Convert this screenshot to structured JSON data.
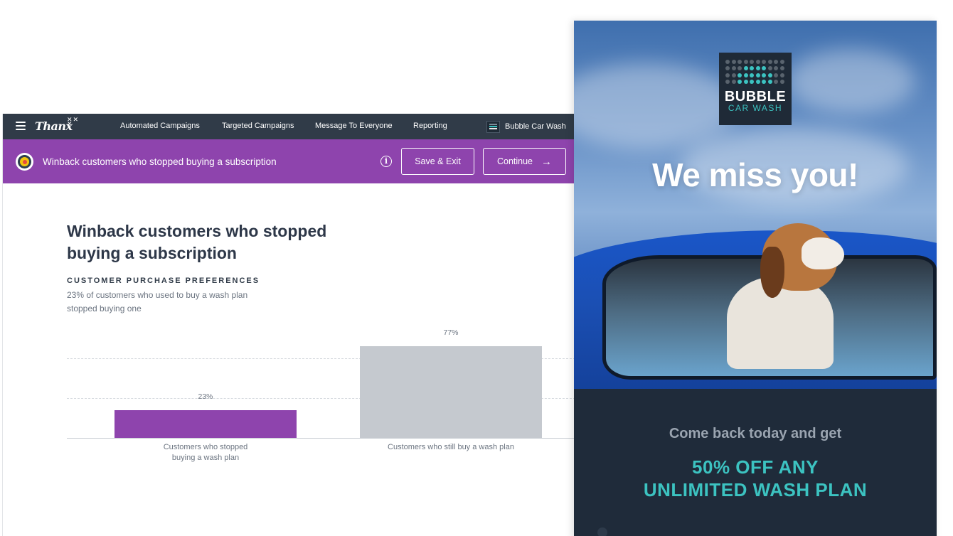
{
  "app": {
    "logo": "Thanx",
    "nav": [
      "Automated Campaigns",
      "Targeted Campaigns",
      "Message To Everyone",
      "Reporting"
    ],
    "account_name": "Bubble Car Wash",
    "campaign_title": "Winback customers who stopped buying a subscription",
    "save_label": "Save & Exit",
    "continue_label": "Continue",
    "accent_color": "#8e44ad"
  },
  "content": {
    "title": "Winback customers who stopped buying a subscription",
    "section_label": "CUSTOMER PURCHASE PREFERENCES",
    "section_desc": "23% of customers who used to buy a wash plan stopped buying one"
  },
  "chart_data": {
    "type": "bar",
    "categories": [
      "Customers who stopped buying a wash plan",
      "Customers who still buy a wash plan"
    ],
    "values": [
      23,
      77
    ],
    "value_labels": [
      "23%",
      "77%"
    ],
    "colors": [
      "#8e44ad",
      "#c5c9cf"
    ],
    "ylim": [
      0,
      100
    ],
    "grid": true
  },
  "email": {
    "brand_name": "BUBBLE",
    "brand_sub": "CAR WASH",
    "headline": "We miss you!",
    "lead": "Come back today and get",
    "offer_line1": "50% OFF ANY",
    "offer_line2": "UNLIMITED WASH PLAN",
    "teal": "#3cc3c1",
    "navy": "#1f2b3a"
  }
}
